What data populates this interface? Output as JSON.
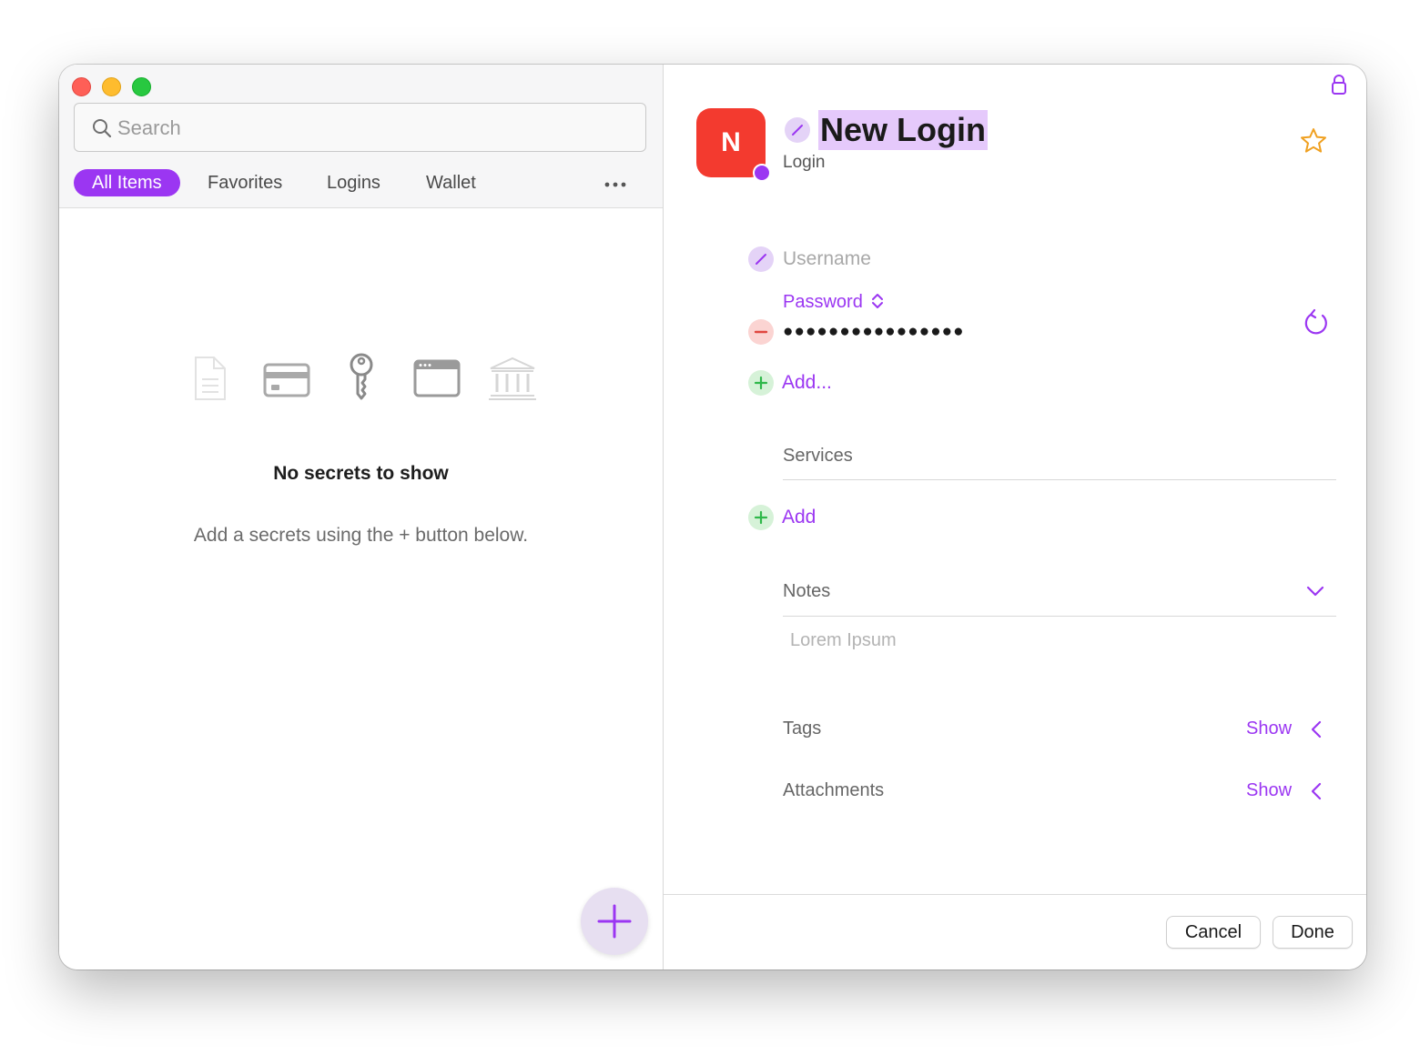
{
  "search": {
    "placeholder": "Search"
  },
  "tabs": [
    {
      "label": "All Items",
      "active": true
    },
    {
      "label": "Favorites",
      "active": false
    },
    {
      "label": "Logins",
      "active": false
    },
    {
      "label": "Wallet",
      "active": false
    }
  ],
  "empty_state": {
    "icons": [
      "document-icon",
      "credit-card-icon",
      "key-icon",
      "browser-window-icon",
      "bank-icon"
    ],
    "title": "No secrets to show",
    "subtitle": "Add a secrets using the + button below."
  },
  "item": {
    "avatar_letter": "N",
    "avatar_color": "#f33a2f",
    "title": "New Login",
    "type": "Login",
    "username_placeholder": "Username",
    "password_label": "Password",
    "password_value": "●●●●●●●●●●●●●●●●",
    "add_field": "Add...",
    "services_label": "Services",
    "add_service": "Add",
    "notes_label": "Notes",
    "notes_placeholder": "Lorem Ipsum",
    "tags_label": "Tags",
    "tags_action": "Show",
    "attachments_label": "Attachments",
    "attachments_action": "Show"
  },
  "footer": {
    "cancel": "Cancel",
    "done": "Done"
  },
  "colors": {
    "accent": "#9b36f2",
    "star": "#f0a020",
    "danger": "#e0463f",
    "success": "#2fb84a"
  }
}
